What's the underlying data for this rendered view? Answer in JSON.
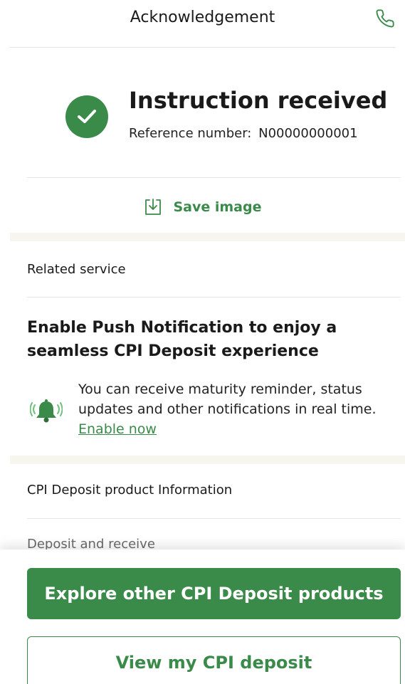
{
  "header": {
    "title": "Acknowledgement",
    "icon": "phone-icon"
  },
  "acknowledgement": {
    "status_icon": "check-circle-icon",
    "title": "Instruction received",
    "reference_label": "Reference number:",
    "reference_value": "N00000000001",
    "save_label": "Save image",
    "save_icon": "download-icon"
  },
  "related_service": {
    "heading": "Related service",
    "push_title": "Enable Push Notification to enjoy a seamless CPI Deposit experience",
    "icon": "bell-ringing-icon",
    "description": "You can receive maturity reminder, status updates and other notifications in real time.",
    "enable_link": "Enable now"
  },
  "product_info": {
    "heading": "CPI Deposit product Information",
    "partial_text": "Deposit and receive"
  },
  "actions": {
    "primary_label": "Explore other CPI Deposit products",
    "secondary_label": "View my CPI deposit"
  },
  "colors": {
    "brand_green": "#3a8a4a",
    "band": "#f7f6ee",
    "divider": "#e6e6e6"
  }
}
